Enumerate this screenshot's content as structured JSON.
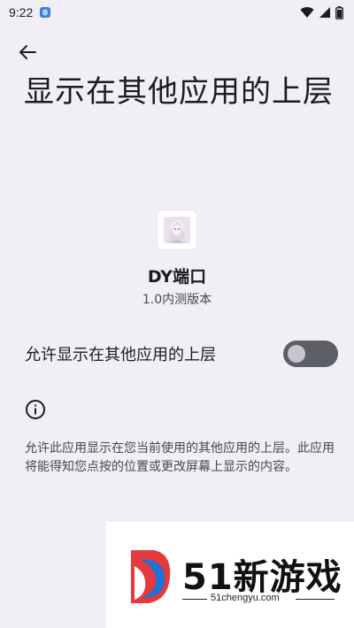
{
  "status_bar": {
    "time": "9:22",
    "notification_icon": "app-notification-icon",
    "icons": [
      "wifi-icon",
      "cell-signal-icon",
      "battery-icon"
    ]
  },
  "header": {
    "back_icon": "arrow-back-icon",
    "title": "显示在其他应用的上层"
  },
  "app": {
    "name": "DY端口",
    "version": "1.0内测版本"
  },
  "permission": {
    "label": "允许显示在其他应用的上层",
    "enabled": false
  },
  "info": {
    "icon": "info-icon",
    "description": "允许此应用显示在您当前使用的其他应用的上层。此应用将能得知您点按的位置或更改屏幕上显示的内容。"
  },
  "watermark": {
    "brand": "51新游戏",
    "url": "51chengyu.com"
  },
  "colors": {
    "background": "#f1eff5",
    "text_primary": "#1c1b1f",
    "text_secondary": "#49454f",
    "switch_track_off": "#5d5f66",
    "switch_thumb_off": "#c6c4cc"
  }
}
